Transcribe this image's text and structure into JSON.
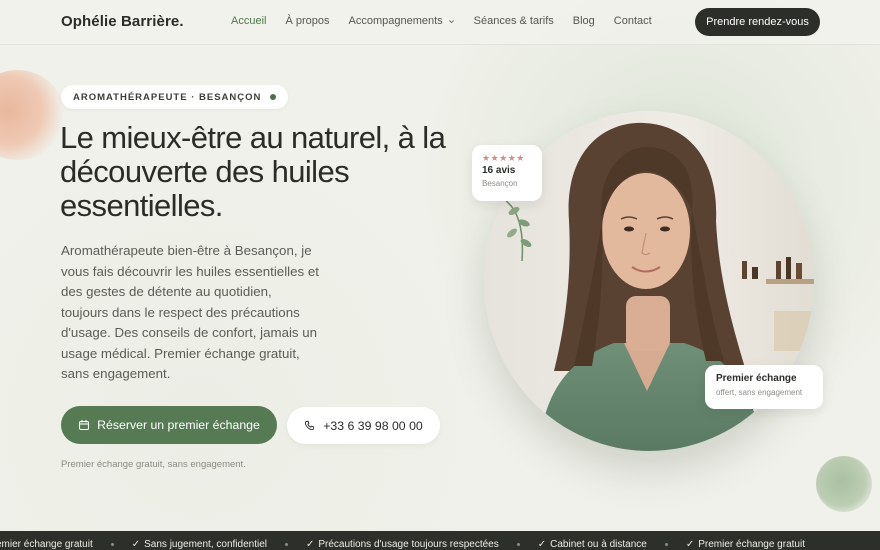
{
  "header": {
    "brand": "Ophélie Barrière.",
    "nav": [
      {
        "label": "Accueil",
        "active": true
      },
      {
        "label": "À propos"
      },
      {
        "label": "Accompagnements",
        "has_dropdown": true
      },
      {
        "label": "Séances & tarifs"
      },
      {
        "label": "Blog"
      },
      {
        "label": "Contact"
      }
    ],
    "cta": "Prendre rendez-vous"
  },
  "hero": {
    "eyebrow": "AROMATHÉRAPEUTE · BESANÇON",
    "title": "Le mieux-être au naturel, à la découverte des huiles essentielles.",
    "lead": "Aromathérapeute bien-être à Besançon, je vous fais découvrir les huiles essentielles et des gestes de détente au quotidien, toujours dans le respect des précautions d'usage. Des conseils de confort, jamais un usage médical. Premier échange gratuit, sans engagement.",
    "primary_button": "Réserver un premier échange",
    "phone_button": "+33 6 39 98 00 00",
    "note": "Premier échange gratuit, sans engagement."
  },
  "reviews_card": {
    "stars": "★★★★★",
    "rating": 5,
    "count": "16 avis",
    "city": "Besançon"
  },
  "first_card": {
    "title": "Premier échange",
    "subtitle": "offert, sans engagement"
  },
  "ticker": [
    "Premier échange gratuit",
    "Sans jugement, confidentiel",
    "Précautions d'usage toujours respectées",
    "Cabinet ou à distance",
    "Premier échange gratuit"
  ],
  "colors": {
    "accent_green": "#567b54",
    "dark": "#2c2e29",
    "background": "#f0f1ea",
    "star": "#c98f86"
  }
}
